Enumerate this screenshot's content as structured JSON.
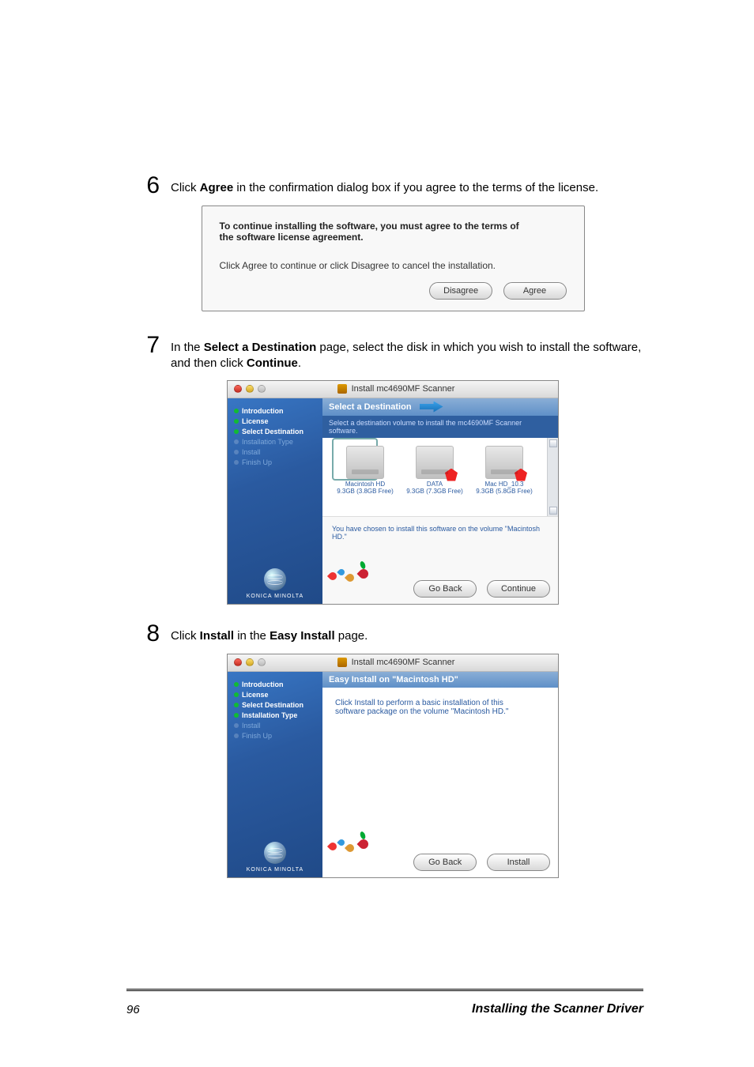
{
  "steps": {
    "s6": {
      "num": "6",
      "pre": "Click ",
      "bold": "Agree",
      "post": " in the confirmation dialog box if you agree to the terms of the license."
    },
    "s7": {
      "num": "7",
      "pre": "In the ",
      "bold1": "Select a Destination",
      "mid": " page, select the disk in which you wish to install the software, and then click ",
      "bold2": "Continue",
      "post": "."
    },
    "s8": {
      "num": "8",
      "pre": "Click ",
      "bold1": "Install",
      "mid": " in the ",
      "bold2": "Easy Install",
      "post": " page."
    }
  },
  "dialog1": {
    "line1a": "To continue installing the software, you must agree to the terms of",
    "line1b": "the software license agreement.",
    "line2": "Click Agree to continue or click Disagree to cancel the installation.",
    "btn_disagree": "Disagree",
    "btn_agree": "Agree"
  },
  "installer": {
    "title": "Install mc4690MF Scanner",
    "side_items": [
      "Introduction",
      "License",
      "Select Destination",
      "Installation Type",
      "Install",
      "Finish Up"
    ],
    "km": "KONICA MINOLTA"
  },
  "screen2": {
    "head": "Select a Destination",
    "sub": "Select a destination volume to install the mc4690MF Scanner software.",
    "vols": [
      {
        "name": "Macintosh HD",
        "free": "9.3GB (3.8GB Free)"
      },
      {
        "name": "DATA",
        "free": "9.3GB (7.3GB Free)"
      },
      {
        "name": "Mac HD_10.3",
        "free": "9.3GB (5.8GB Free)"
      }
    ],
    "chosen_msg": "You have chosen to install this software on the volume \"Macintosh HD.\"",
    "btn_back": "Go Back",
    "btn_cont": "Continue"
  },
  "screen3": {
    "head": "Easy Install on \"Macintosh HD\"",
    "msg1": "Click Install to perform a basic installation of this",
    "msg2": "software package on the volume \"Macintosh HD.\"",
    "btn_back": "Go Back",
    "btn_inst": "Install"
  },
  "footer": {
    "page": "96",
    "title": "Installing the Scanner Driver"
  }
}
